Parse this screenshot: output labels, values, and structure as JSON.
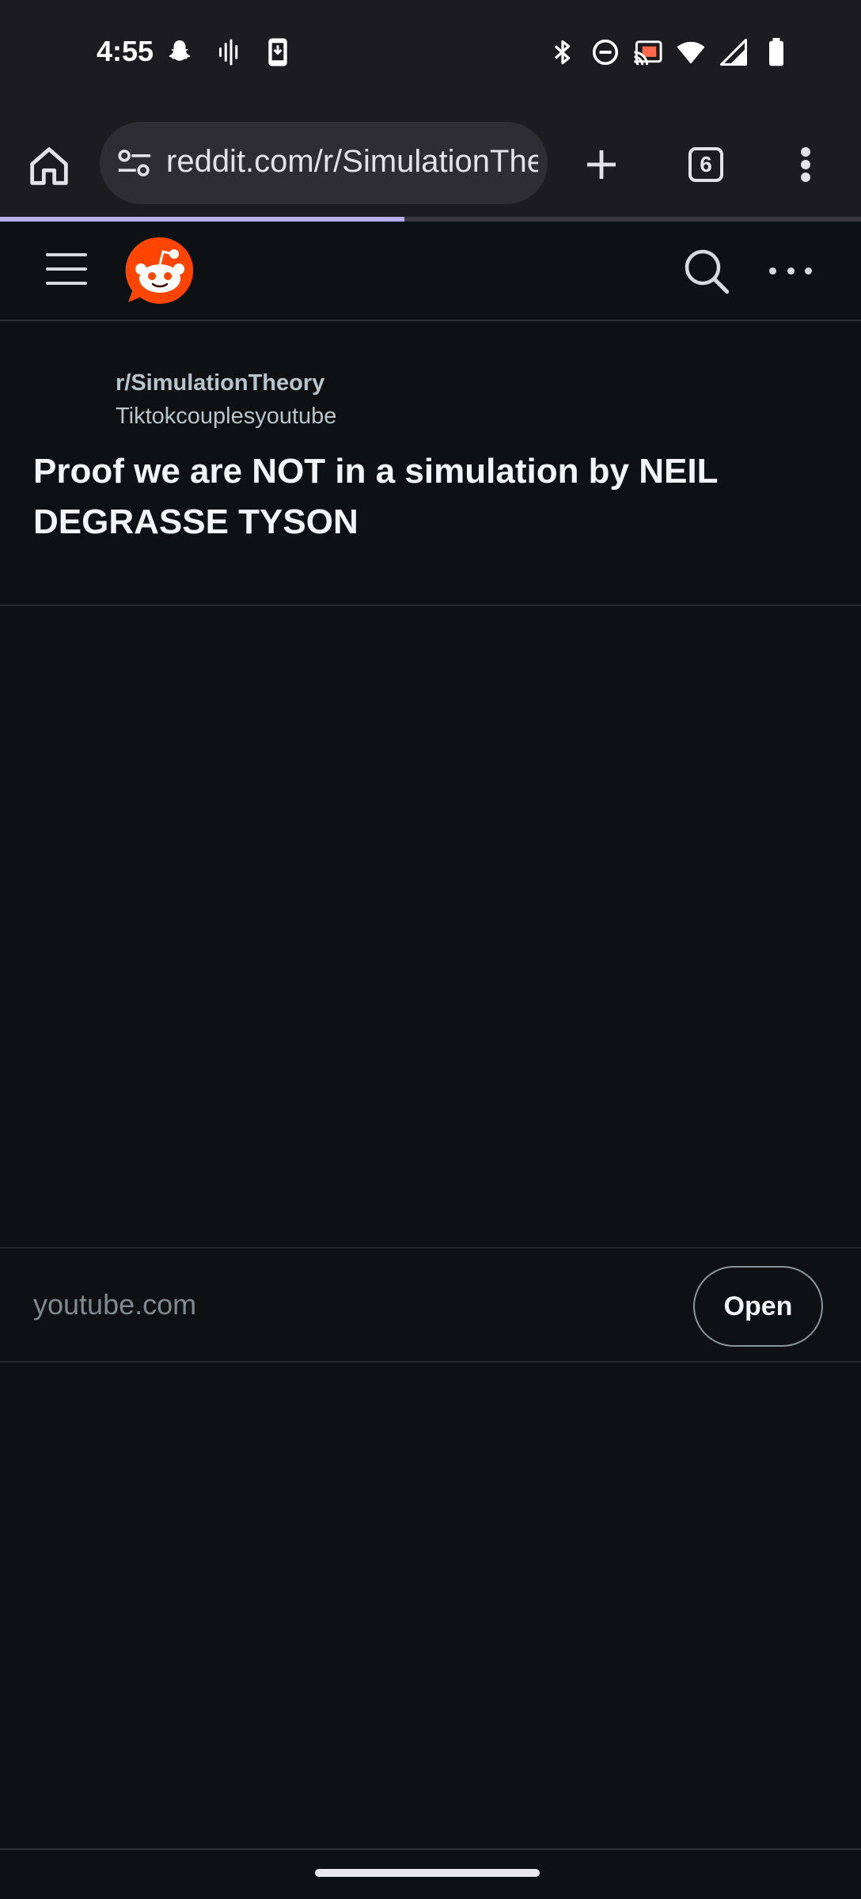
{
  "status_bar": {
    "time": "4:55",
    "left_icons": [
      "snapchat-icon",
      "voice-icon",
      "download-icon"
    ],
    "right_icons": [
      "bluetooth-icon",
      "do-not-disturb-icon",
      "cast-icon",
      "wifi-icon",
      "signal-icon",
      "battery-icon"
    ]
  },
  "browser": {
    "url": "reddit.com/r/SimulationTheory",
    "tab_count": "6",
    "load_progress": 0.47,
    "icons": [
      "home-icon",
      "site-settings-icon",
      "new-tab-icon",
      "tab-switcher-icon",
      "menu-icon"
    ]
  },
  "reddit_header": {
    "icons": [
      "hamburger-menu-icon",
      "reddit-logo",
      "search-icon",
      "more-icon"
    ]
  },
  "post": {
    "subreddit": "r/SimulationTheory",
    "author": "Tiktokcouplesyoutube",
    "title": "Proof we are NOT in a simulation by NEIL DEGRASSE TYSON"
  },
  "link": {
    "domain": "youtube.com",
    "open_label": "Open"
  },
  "colors": {
    "background": "#0e1114",
    "toolbar": "#1c1b20",
    "reddit_orange": "#ff4500",
    "progress": "#b7aef5"
  }
}
